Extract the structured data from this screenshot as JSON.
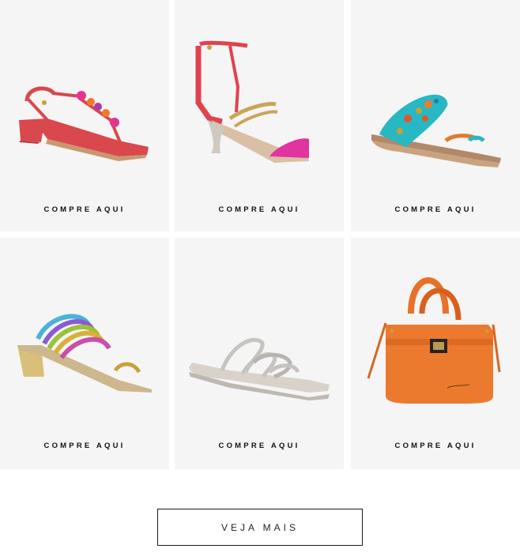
{
  "products": [
    {
      "cta": "COMPRE AQUI",
      "icon": "red-flat-sandal-with-flowers-icon"
    },
    {
      "cta": "COMPRE AQUI",
      "icon": "red-gold-heeled-sandal-icon"
    },
    {
      "cta": "COMPRE AQUI",
      "icon": "turquoise-beaded-slide-sandal-icon"
    },
    {
      "cta": "COMPRE AQUI",
      "icon": "rainbow-metallic-block-heel-sandal-icon"
    },
    {
      "cta": "COMPRE AQUI",
      "icon": "silver-strappy-flat-sandal-icon"
    },
    {
      "cta": "COMPRE AQUI",
      "icon": "orange-leather-handbag-icon"
    }
  ],
  "veja_mais": "VEJA MAIS",
  "colors": {
    "card_bg": "#f5f5f5",
    "text": "#111111",
    "button_border": "#1a1a1a"
  }
}
